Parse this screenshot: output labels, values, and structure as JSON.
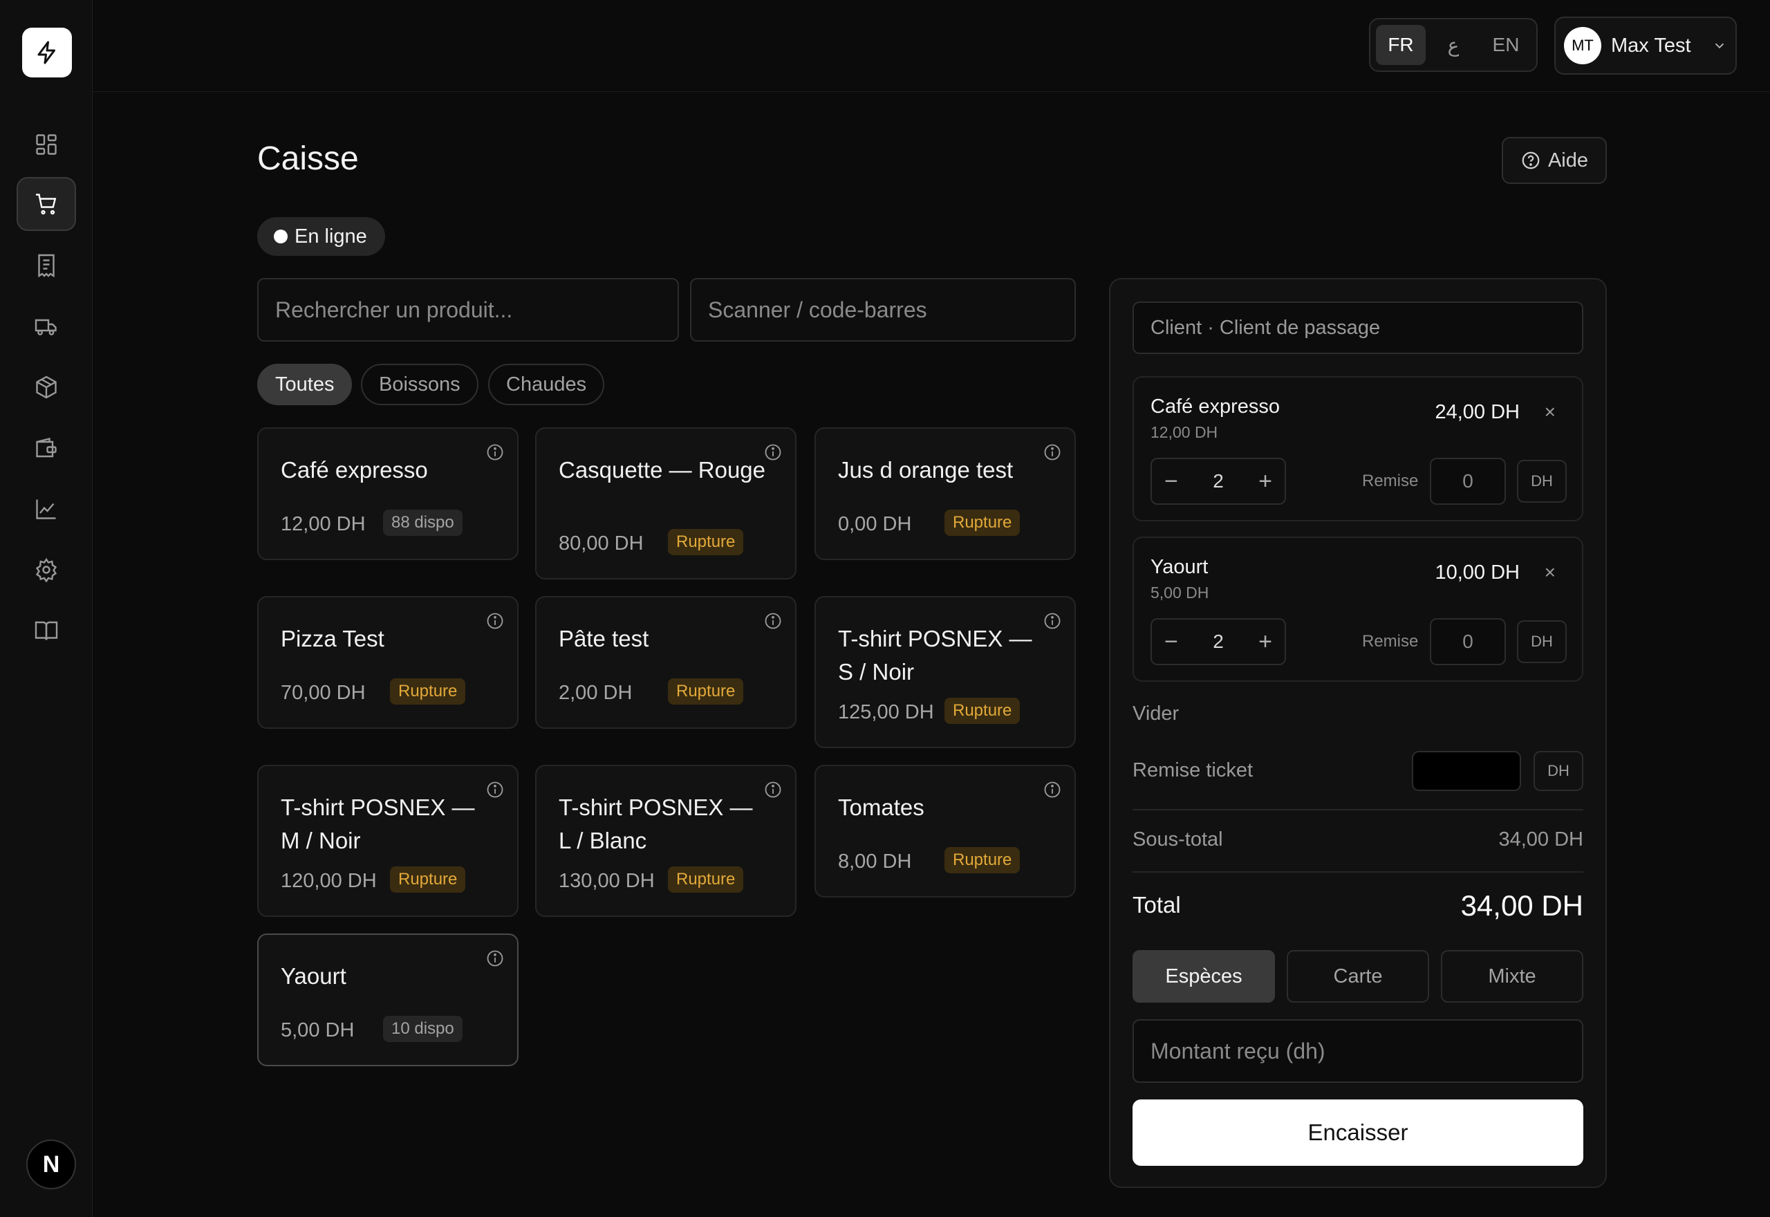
{
  "topbar": {
    "languages": [
      {
        "label": "FR",
        "active": true
      },
      {
        "label": "ع",
        "active": false
      },
      {
        "label": "EN",
        "active": false
      }
    ],
    "user": {
      "initials": "MT",
      "name": "Max Test"
    }
  },
  "sidebar": {
    "items": [
      {
        "icon": "dashboard-icon",
        "active": false
      },
      {
        "icon": "cart-icon",
        "active": true
      },
      {
        "icon": "receipt-icon",
        "active": false
      },
      {
        "icon": "truck-icon",
        "active": false
      },
      {
        "icon": "package-icon",
        "active": false
      },
      {
        "icon": "wallet-icon",
        "active": false
      },
      {
        "icon": "chart-icon",
        "active": false
      },
      {
        "icon": "gear-icon",
        "active": false
      },
      {
        "icon": "book-icon",
        "active": false
      }
    ],
    "bottom_badge": "N"
  },
  "page": {
    "title": "Caisse",
    "help_label": "Aide",
    "status": "En ligne"
  },
  "search": {
    "product_placeholder": "Rechercher un produit...",
    "barcode_placeholder": "Scanner / code-barres"
  },
  "filters": [
    {
      "label": "Toutes",
      "active": true
    },
    {
      "label": "Boissons",
      "active": false
    },
    {
      "label": "Chaudes",
      "active": false
    }
  ],
  "products": [
    {
      "name": "Café expresso",
      "price": "12,00 DH",
      "badge": "88 dispo",
      "badge_type": "dispo"
    },
    {
      "name": "Casquette — Rouge",
      "price": "80,00 DH",
      "badge": "Rupture",
      "badge_type": "rupture"
    },
    {
      "name": "Jus d orange test",
      "price": "0,00 DH",
      "badge": "Rupture",
      "badge_type": "rupture"
    },
    {
      "name": "Pizza Test",
      "price": "70,00 DH",
      "badge": "Rupture",
      "badge_type": "rupture"
    },
    {
      "name": "Pâte test",
      "price": "2,00 DH",
      "badge": "Rupture",
      "badge_type": "rupture"
    },
    {
      "name": "T-shirt POSNEX — S / Noir",
      "price": "125,00 DH",
      "badge": "Rupture",
      "badge_type": "rupture"
    },
    {
      "name": "T-shirt POSNEX — M / Noir",
      "price": "120,00 DH",
      "badge": "Rupture",
      "badge_type": "rupture"
    },
    {
      "name": "T-shirt POSNEX — L / Blanc",
      "price": "130,00 DH",
      "badge": "Rupture",
      "badge_type": "rupture"
    },
    {
      "name": "Tomates",
      "price": "8,00 DH",
      "badge": "Rupture",
      "badge_type": "rupture"
    },
    {
      "name": "Yaourt",
      "price": "5,00 DH",
      "badge": "10 dispo",
      "badge_type": "dispo"
    }
  ],
  "cart": {
    "client": "Client · Client de passage",
    "items": [
      {
        "name": "Café expresso",
        "unit_price": "12,00 DH",
        "total": "24,00 DH",
        "qty": "2",
        "discount": "0"
      },
      {
        "name": "Yaourt",
        "unit_price": "5,00 DH",
        "total": "10,00 DH",
        "qty": "2",
        "discount": "0"
      }
    ],
    "remove_symbol": "×",
    "minus_symbol": "−",
    "plus_symbol": "+",
    "remise_label": "Remise",
    "currency_unit": "DH",
    "clear_label": "Vider",
    "ticket_discount_label": "Remise ticket",
    "subtotal_label": "Sous-total",
    "subtotal_value": "34,00 DH",
    "total_label": "Total",
    "total_value": "34,00 DH",
    "payment_methods": [
      {
        "label": "Espèces",
        "active": true
      },
      {
        "label": "Carte",
        "active": false
      },
      {
        "label": "Mixte",
        "active": false
      }
    ],
    "amount_placeholder": "Montant reçu (dh)",
    "checkout_label": "Encaisser"
  },
  "colors": {
    "background": "#0b0b0b",
    "accent_warning": "#e2a93a",
    "primary_button": "#ffffff"
  }
}
